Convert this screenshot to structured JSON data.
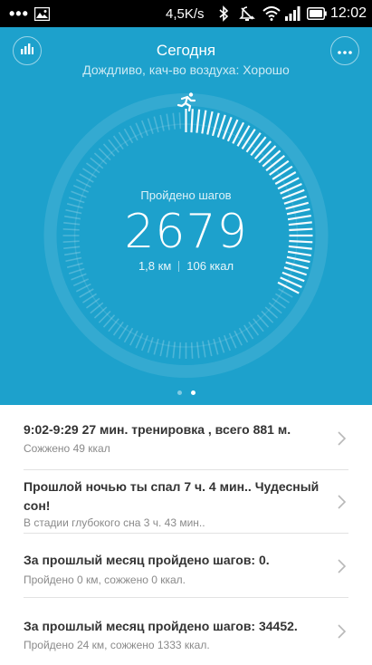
{
  "status_bar": {
    "speed": "4,5K/s",
    "time": "12:02",
    "icons": [
      "more-dots-icon",
      "image-icon",
      "bluetooth-icon",
      "alarm-icon",
      "wifi-icon",
      "signal-icon",
      "battery-icon"
    ]
  },
  "header": {
    "title": "Сегодня",
    "subtitle": "Дождливо, кач-во воздуха: Хорошо"
  },
  "activity": {
    "label": "Пройдено шагов",
    "steps": "2679",
    "distance": "1,8 км",
    "calories": "106 ккал",
    "goal_progress": 0.33,
    "pages": 2,
    "active_page": 2
  },
  "colors": {
    "hero_background": "#1da1cc",
    "feed_title": "#333333",
    "feed_desc": "#8a8a8a"
  },
  "feed": [
    {
      "title": "9:02-9:29  27 мин. тренировка , всего 881 м.",
      "desc": "Сожжено 49 ккал"
    },
    {
      "title": "Прошлой ночью ты спал 7 ч. 4 мин.. Чудесный сон!",
      "desc": "В стадии глубокого сна 3 ч. 43 мин.."
    },
    {
      "title": "За прошлый месяц пройдено шагов: 0.",
      "desc": "Пройдено 0 км, сожжено 0 ккал."
    },
    {
      "title": "За прошлый месяц пройдено шагов: 34452.",
      "desc": "Пройдено 24 км, сожжено 1333 ккал."
    }
  ]
}
